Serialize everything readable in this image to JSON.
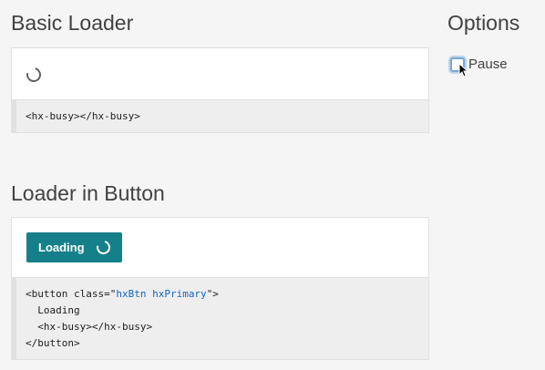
{
  "sections": {
    "basic": {
      "title": "Basic Loader",
      "code": "<hx-busy></hx-busy>"
    },
    "button": {
      "title": "Loader in Button",
      "button_label": "Loading",
      "code_lines": {
        "l1_start": "<button class=\"",
        "l1_val": "hxBtn hxPrimary",
        "l1_end": "\">",
        "l2": "  Loading",
        "l3": "  <hx-busy></hx-busy>",
        "l4": "</button>"
      }
    }
  },
  "options": {
    "title": "Options",
    "pause_label": "Pause",
    "pause_checked": false
  },
  "colors": {
    "primary": "#16808a",
    "background": "#f5f5f5"
  },
  "icons": {
    "loader": "spinner-icon",
    "cursor": "cursor-arrow-icon"
  }
}
